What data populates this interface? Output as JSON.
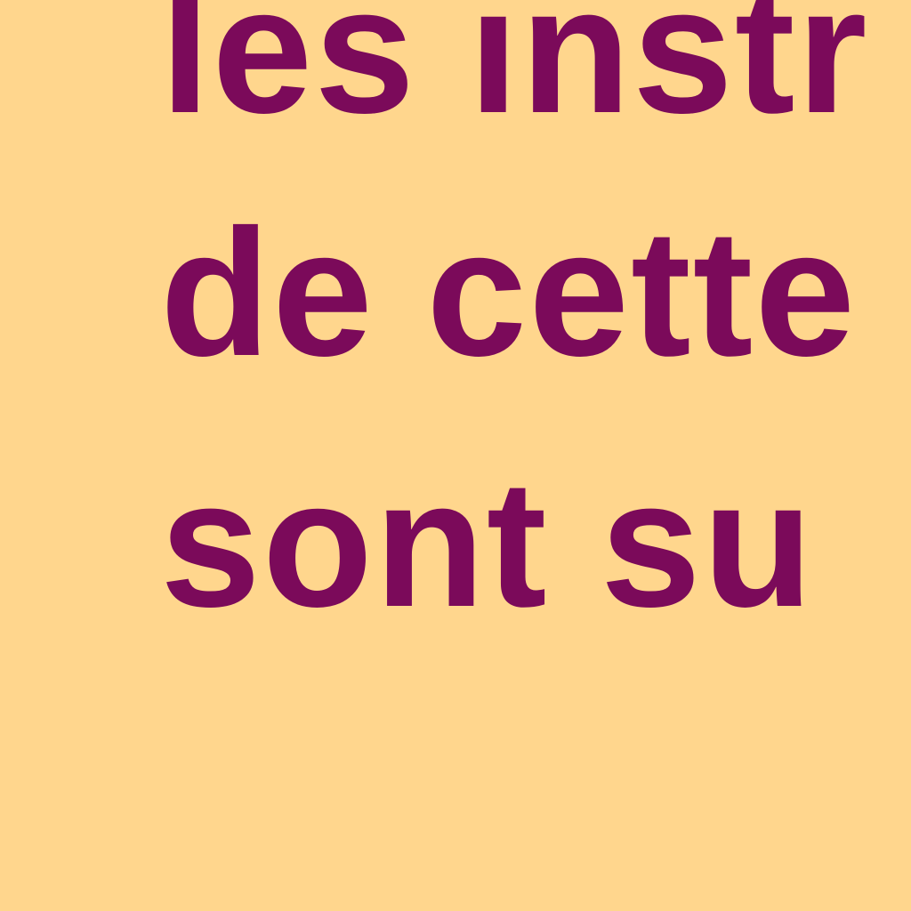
{
  "colors": {
    "background": "#FFD68D",
    "text": "#7B0A5A"
  },
  "lines": [
    "les instr",
    "de cette",
    "sont su"
  ]
}
